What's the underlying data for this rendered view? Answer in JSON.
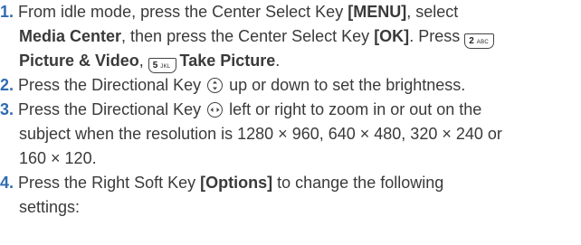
{
  "steps": [
    {
      "number": "1.",
      "l1_t1": "From idle mode, press the Center Select Key ",
      "l1_b1": "[MENU]",
      "l1_t2": ", select",
      "l2_b1": "Media Center",
      "l2_t1": ", then press the Center Select Key ",
      "l2_b2": "[OK]",
      "l2_t2": ". Press ",
      "key_2_num": "2",
      "key_2_sub": "ABC",
      "l3_b1": "Picture & Video",
      "l3_t1": ", ",
      "key_5_num": "5",
      "key_5_sub": "JKL",
      "l3_b2": "Take Picture",
      "l3_t2": "."
    },
    {
      "number": "2.",
      "l1_t1": "Press the Directional Key ",
      "l1_t2": " up or down to set the brightness."
    },
    {
      "number": "3.",
      "l1_t1": "Press the Directional Key ",
      "l1_t2": " left or right to zoom in or out on the",
      "l2": "subject when the resolution is 1280 × 960, 640 × 480, 320 × 240 or",
      "l3": "160 × 120."
    },
    {
      "number": "4.",
      "l1_t1": "Press the Right Soft Key ",
      "l1_b1": "[Options]",
      "l1_t2": " to change the following",
      "l2": "settings:"
    }
  ],
  "colors": {
    "step_number": "#2f6cb0",
    "text": "#3a3a3a"
  },
  "icons": [
    "key-2-abc-icon",
    "key-5-jkl-icon",
    "directional-up-down-icon",
    "directional-left-right-icon"
  ]
}
